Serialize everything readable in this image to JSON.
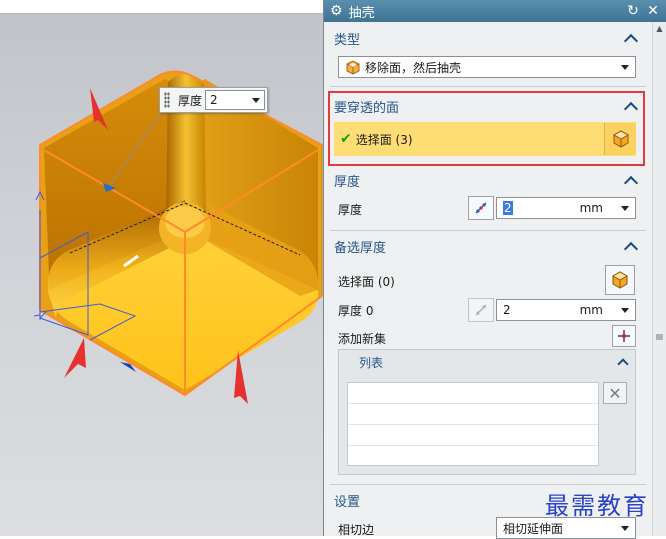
{
  "dialog": {
    "title": "抽壳",
    "type_section": {
      "heading": "类型",
      "selected": "移除面，然后抽壳"
    },
    "faces_section": {
      "heading": "要穿透的面",
      "select_label": "选择面 (3)"
    },
    "thickness_section": {
      "heading": "厚度",
      "label": "厚度",
      "value": "2",
      "unit": "mm"
    },
    "alt_section": {
      "heading": "备选厚度",
      "select_label": "选择面 (0)",
      "thickness_label": "厚度 0",
      "value": "2",
      "unit": "mm",
      "add_set_label": "添加新集",
      "list_heading": "列表"
    },
    "settings_section": {
      "heading": "设置",
      "tangent_label": "相切边",
      "tangent_value": "相切延伸面"
    }
  },
  "viewport": {
    "popup": {
      "label": "厚度",
      "value": "2"
    }
  },
  "watermark": "最需教育",
  "colors": {
    "accent": "#26578a",
    "highlight": "#fedd75",
    "selection_box": "#e23b3b",
    "model": "#f0a810"
  }
}
